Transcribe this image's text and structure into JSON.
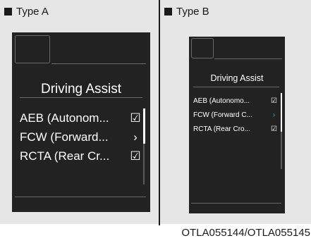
{
  "type_a": {
    "label": "Type A",
    "title": "Driving Assist",
    "items": [
      {
        "label": "AEB (Autonom...",
        "icon": "check-icon",
        "glyph": "☑"
      },
      {
        "label": "FCW (Forward...",
        "icon": "chevron-right-icon",
        "glyph": "›"
      },
      {
        "label": "RCTA (Rear Cr...",
        "icon": "check-icon",
        "glyph": "☑"
      }
    ]
  },
  "type_b": {
    "label": "Type B",
    "title": "Driving Assist",
    "items": [
      {
        "label": "AEB (Autonomo...",
        "icon": "check-icon",
        "glyph": "☑"
      },
      {
        "label": "FCW (Forward C...",
        "icon": "chevron-right-icon",
        "glyph": "›"
      },
      {
        "label": "RCTA (Rear Cro...",
        "icon": "check-icon",
        "glyph": "☑"
      }
    ]
  },
  "caption": "OTLA055144/OTLA055145",
  "colors": {
    "screen_bg": "#222222",
    "chevron_b": "#4aa3ff",
    "panel_bg": "#e6e6e6"
  }
}
